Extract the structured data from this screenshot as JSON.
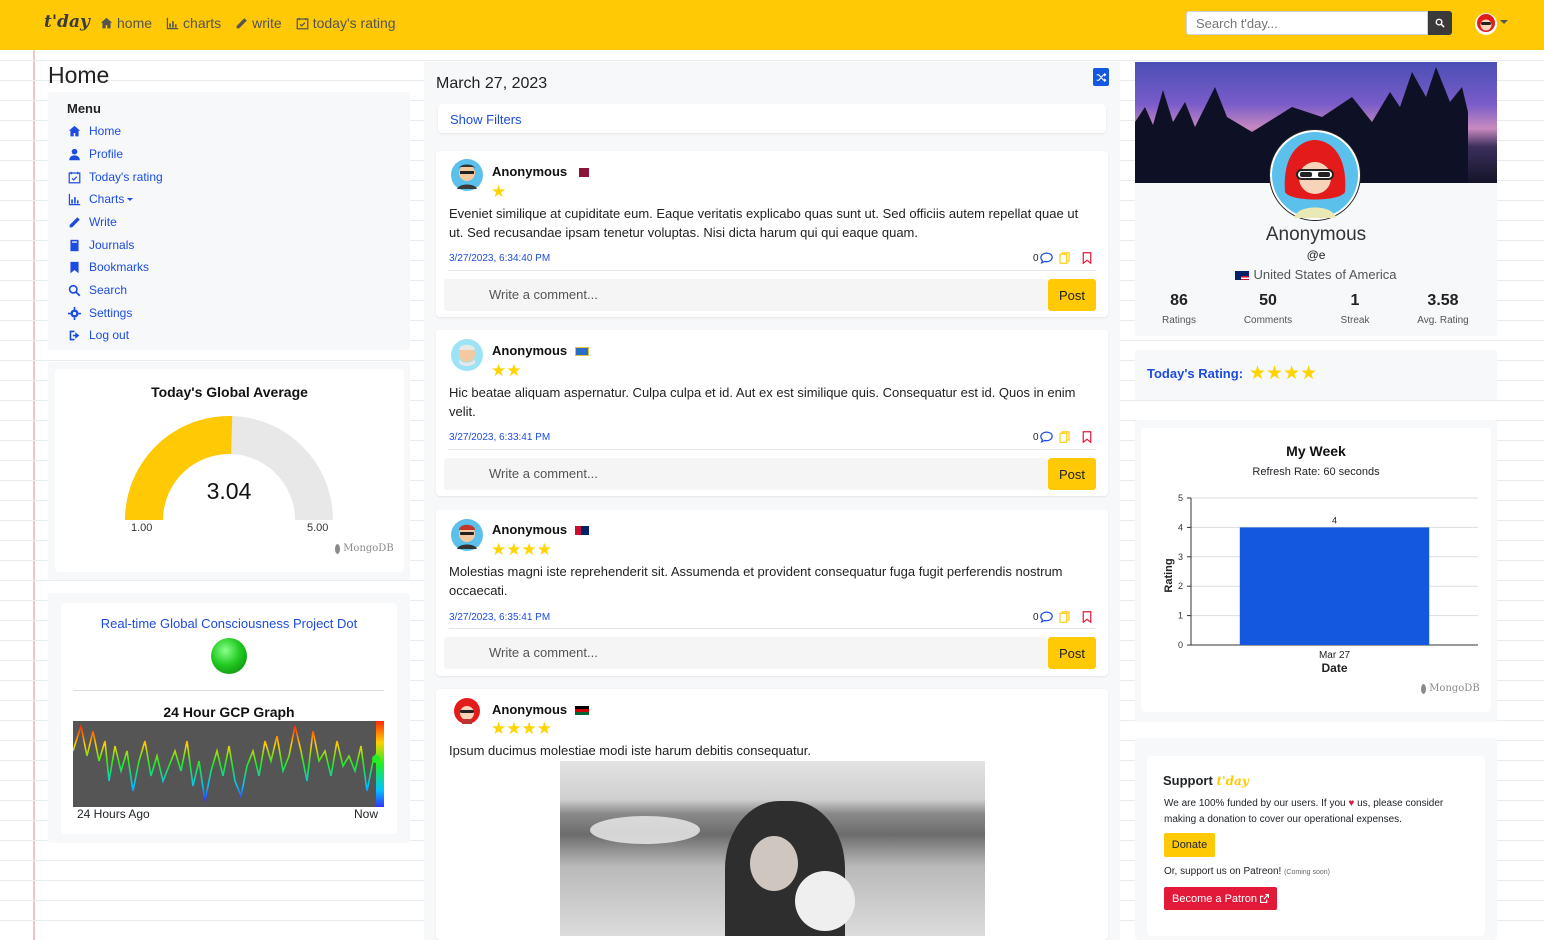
{
  "brand": "t'day",
  "nav": {
    "links": [
      {
        "label": "home",
        "icon": "home-icon"
      },
      {
        "label": "charts",
        "icon": "chart-icon"
      },
      {
        "label": "write",
        "icon": "pencil-icon"
      },
      {
        "label": "today's rating",
        "icon": "calendar-check-icon"
      }
    ],
    "search_placeholder": "Search t'day..."
  },
  "left": {
    "page_title": "Home",
    "menu_title": "Menu",
    "menu": [
      "Home",
      "Profile",
      "Today's rating",
      "Charts",
      "Write",
      "Journals",
      "Bookmarks",
      "Search",
      "Settings",
      "Log out"
    ],
    "gauge": {
      "title": "Today's Global Average",
      "value": "3.04",
      "min": "1.00",
      "max": "5.00",
      "fraction": 0.51,
      "credit": "MongoDB"
    },
    "gcp": {
      "title": "Real-time Global Consciousness Project Dot",
      "graph_title": "24 Hour GCP Graph",
      "left_label": "24 Hours Ago",
      "right_label": "Now",
      "dot_color": "#22cc22"
    }
  },
  "feed": {
    "date": "March 27, 2023",
    "filters": "Show Filters",
    "comment_placeholder": "Write a comment...",
    "post_label": "Post",
    "posts": [
      {
        "name": "Anonymous",
        "stars": "★",
        "text": "Eveniet similique at cupiditate eum. Eaque veritatis explicabo quas sunt ut. Sed officiis autem repellat quae ut ut. Sed recusandae ipsam tenetur voluptas. Nisi dicta harum qui qui eaque quam.",
        "date": "3/27/2023, 6:34:40 PM",
        "comments": "0"
      },
      {
        "name": "Anonymous",
        "stars": "★★",
        "text": "Hic beatae aliquam aspernatur. Culpa culpa et id. Aut ex est similique quis. Consequatur est id. Quos in enim velit.",
        "date": "3/27/2023, 6:33:41 PM",
        "comments": "0"
      },
      {
        "name": "Anonymous",
        "stars": "★★★★",
        "text": "Molestias magni iste reprehenderit sit. Assumenda et provident consequatur fuga fugit perferendis nostrum occaecati.",
        "date": "3/27/2023, 6:35:41 PM",
        "comments": "0"
      },
      {
        "name": "Anonymous",
        "stars": "★★★★",
        "text": "Ipsum ducimus molestiae modi iste harum debitis consequatur."
      }
    ]
  },
  "profile": {
    "name": "Anonymous",
    "handle": "@e",
    "country": "United States of America",
    "stats": [
      {
        "value": "86",
        "label": "Ratings"
      },
      {
        "value": "50",
        "label": "Comments"
      },
      {
        "value": "1",
        "label": "Streak"
      },
      {
        "value": "3.58",
        "label": "Avg. Rating"
      }
    ],
    "todays_rating_label": "Today's Rating:",
    "todays_rating_stars": "★★★★"
  },
  "chart_data": {
    "type": "bar",
    "title": "My Week",
    "subtitle": "Refresh Rate: 60 seconds",
    "categories": [
      "Mar 27"
    ],
    "values": [
      4
    ],
    "xlabel": "Date",
    "ylabel": "Rating",
    "ylim": [
      0,
      5
    ],
    "yticks": [
      "0",
      "1",
      "2",
      "3",
      "4",
      "5"
    ],
    "bar_color": "#1458e0",
    "credit": "MongoDB"
  },
  "support": {
    "title": "Support",
    "brand": "t'day",
    "text_before": "We are 100% funded by our users. If you",
    "text_after": "us, please consider making a donation to cover our operational expenses.",
    "donate": "Donate",
    "patreon_text": "Or, support us on Patreon!",
    "coming_soon": "(Coming soon)",
    "patron_button": "Become a Patron"
  }
}
